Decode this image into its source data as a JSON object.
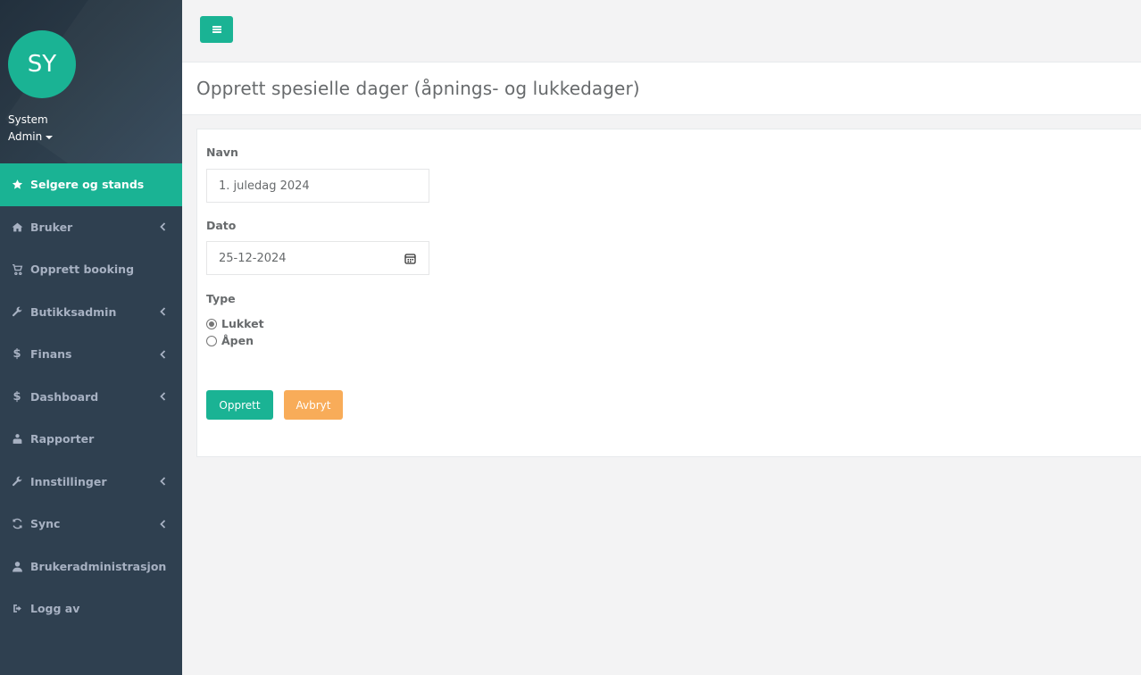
{
  "sidebar": {
    "avatar_initials": "SY",
    "profile_name": "System",
    "profile_role": "Admin",
    "items": [
      {
        "label": "Selgere og stands",
        "icon": "star-icon",
        "active": true,
        "chevron": false
      },
      {
        "label": "Bruker",
        "icon": "home-icon",
        "active": false,
        "chevron": true
      },
      {
        "label": "Opprett booking",
        "icon": "cart-icon",
        "active": false,
        "chevron": false
      },
      {
        "label": "Butikksadmin",
        "icon": "wrench-icon",
        "active": false,
        "chevron": true
      },
      {
        "label": "Finans",
        "icon": "dollar-icon",
        "active": false,
        "chevron": true
      },
      {
        "label": "Dashboard",
        "icon": "dollar-icon",
        "active": false,
        "chevron": true
      },
      {
        "label": "Rapporter",
        "icon": "user-tie-icon",
        "active": false,
        "chevron": false
      },
      {
        "label": "Innstillinger",
        "icon": "wrench-icon",
        "active": false,
        "chevron": true
      },
      {
        "label": "Sync",
        "icon": "sync-icon",
        "active": false,
        "chevron": true
      },
      {
        "label": "Brukeradministrasjon",
        "icon": "user-icon",
        "active": false,
        "chevron": false
      },
      {
        "label": "Logg av",
        "icon": "sign-out-icon",
        "active": false,
        "chevron": false
      }
    ]
  },
  "page": {
    "title": "Opprett spesielle dager (åpnings- og lukkedager)"
  },
  "form": {
    "name_label": "Navn",
    "name_value": "1. juledag 2024",
    "date_label": "Dato",
    "date_value": "25-12-2024",
    "type_label": "Type",
    "type_options": [
      {
        "label": "Lukket",
        "checked": true
      },
      {
        "label": "Åpen",
        "checked": false
      }
    ],
    "submit_label": "Opprett",
    "cancel_label": "Avbryt"
  },
  "colors": {
    "sidebar_bg": "#2f4050",
    "accent": "#1ab394",
    "warning": "#f8ac59"
  }
}
